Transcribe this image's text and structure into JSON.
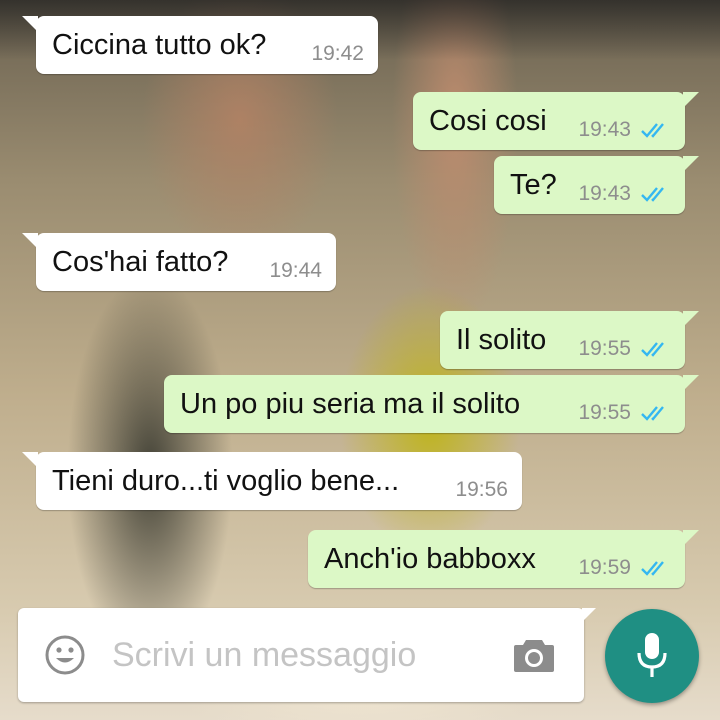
{
  "chat": {
    "messages": [
      {
        "direction": "in",
        "text": "Ciccina tutto ok?",
        "time": "19:42"
      },
      {
        "direction": "out",
        "text": "Cosi cosi",
        "time": "19:43",
        "status": "read"
      },
      {
        "direction": "out",
        "text": "Te?",
        "time": "19:43",
        "status": "read"
      },
      {
        "direction": "in",
        "text": "Cos'hai fatto?",
        "time": "19:44"
      },
      {
        "direction": "out",
        "text": "Il solito",
        "time": "19:55",
        "status": "read"
      },
      {
        "direction": "out",
        "text": "Un po piu seria ma il solito",
        "time": "19:55",
        "status": "read"
      },
      {
        "direction": "in",
        "text": "Tieni duro...ti voglio bene...",
        "time": "19:56"
      },
      {
        "direction": "out",
        "text": "Anch'io babboxx",
        "time": "19:59",
        "status": "read"
      }
    ]
  },
  "composer": {
    "placeholder": "Scrivi un messaggio",
    "value": "",
    "emoji_icon": "emoji-icon",
    "camera_icon": "camera-icon",
    "mic_icon": "mic-icon"
  },
  "colors": {
    "incoming_bubble": "#ffffff",
    "outgoing_bubble": "#dcf8c6",
    "read_ticks": "#34b7f1",
    "mic_button": "#1f8f83",
    "timestamp": "#8d8d8d"
  }
}
